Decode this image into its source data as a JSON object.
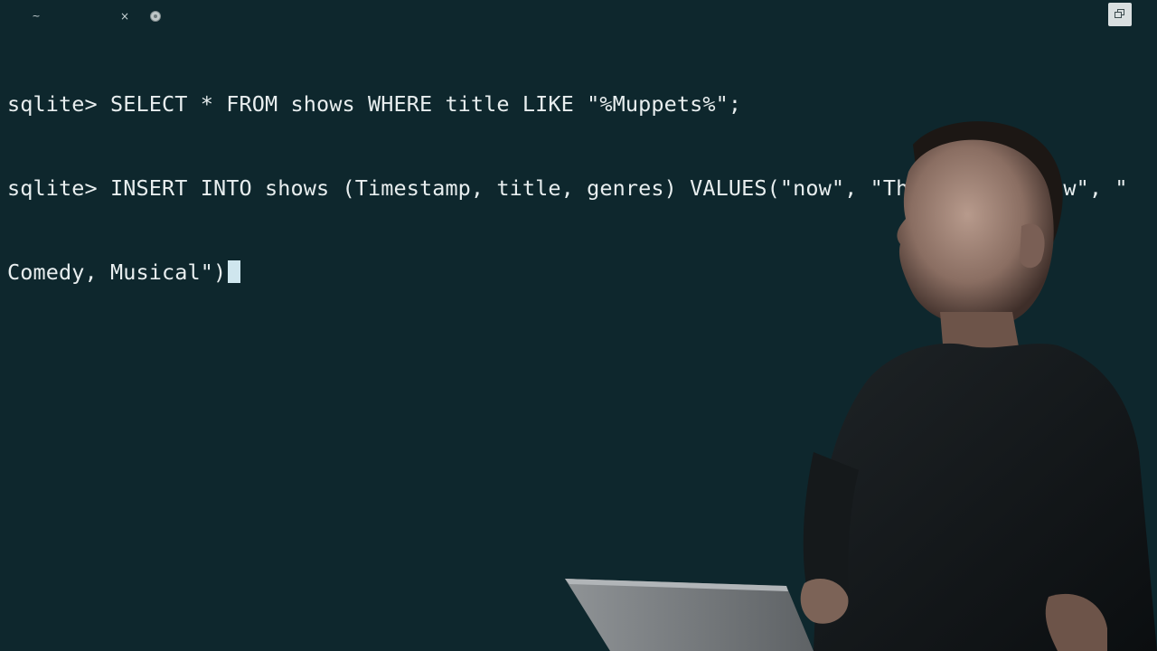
{
  "tabbar": {
    "tab_icon": "~",
    "close_symbol": "×",
    "icons": [
      "tilde-icon",
      "close-icon",
      "record-dot-icon",
      "maximize-icon"
    ]
  },
  "terminal": {
    "lines": [
      "sqlite> SELECT * FROM shows WHERE title LIKE \"%Muppets%\";",
      "sqlite> INSERT INTO shows (Timestamp, title, genres) VALUES(\"now\", \"The Muppet Show\", \"",
      "Comedy, Musical\")"
    ]
  },
  "colors": {
    "background": "#0e272d",
    "text": "#e8eeef",
    "cursor": "#cfe6ee"
  }
}
